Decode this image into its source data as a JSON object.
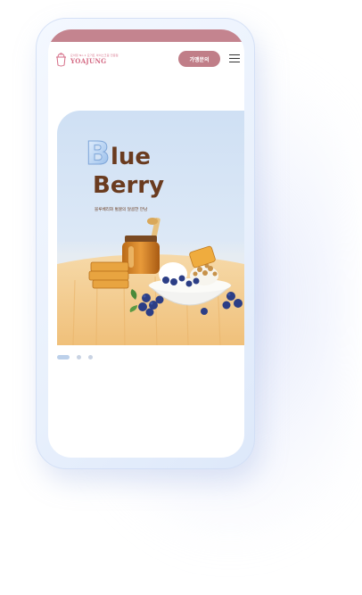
{
  "brand": {
    "tagline": "요아정 No.1 요거트 아이스크림 전문점",
    "name": "YOAJUNG",
    "color": "#d46a84"
  },
  "header": {
    "inquiry_label": "가맹문의",
    "top_bar_color": "#c4848f",
    "menu_icon": "hamburger-menu-icon"
  },
  "banner": {
    "title_initial": "B",
    "title_rest": "lue",
    "title_second": "Berry",
    "subtitle": "블루베리와 벌꿀의 달콤한 만남",
    "active_slide": 1,
    "slide_count": 3
  }
}
